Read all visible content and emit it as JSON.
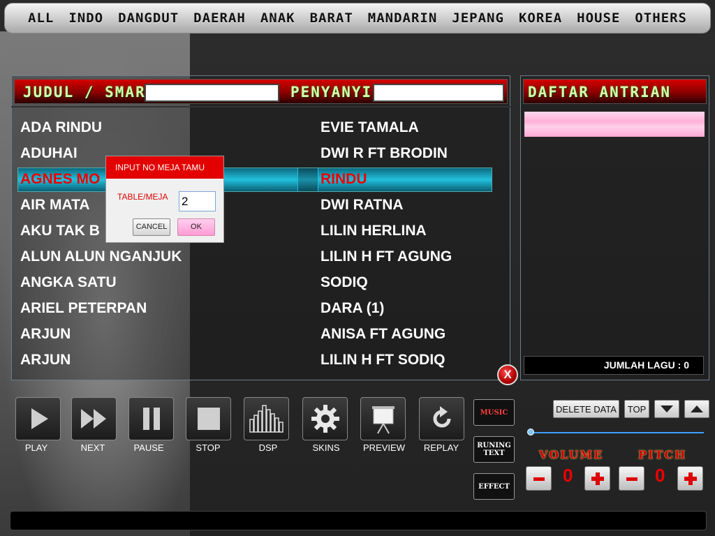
{
  "categories": [
    "ALL",
    "INDO",
    "DANGDUT",
    "DAERAH",
    "ANAK",
    "BARAT",
    "MANDARIN",
    "JEPANG",
    "KOREA",
    "HOUSE",
    "OTHERS"
  ],
  "search": {
    "judul_label": "JUDUL / SMART",
    "penyanyi_label": "PENYANYI",
    "judul_value": "",
    "penyanyi_value": ""
  },
  "songs": [
    "ADA RINDU",
    "ADUHAI",
    "AGNES MO",
    "AIR MATA",
    "AKU TAK B",
    "ALUN ALUN NGANJUK",
    "ANGKA SATU",
    "ARIEL PETERPAN",
    "ARJUN",
    "ARJUN"
  ],
  "artists": [
    "EVIE TAMALA",
    "DWI R FT BRODIN",
    "RINDU",
    "DWI RATNA",
    "LILIN HERLINA",
    "LILIN H FT AGUNG",
    "SODIQ",
    "DARA (1)",
    "ANISA FT AGUNG",
    "LILIN H FT SODIQ"
  ],
  "selected_index": 2,
  "queue": {
    "title": "DAFTAR ANTRIAN",
    "count_label": "JUMLAH LAGU : 0"
  },
  "close_label": "X",
  "controls": [
    {
      "label": "PLAY",
      "icon": "play-icon"
    },
    {
      "label": "NEXT",
      "icon": "next-icon"
    },
    {
      "label": "PAUSE",
      "icon": "pause-icon"
    },
    {
      "label": "STOP",
      "icon": "stop-icon"
    },
    {
      "label": "DSP",
      "icon": "equalizer-icon"
    },
    {
      "label": "SKINS",
      "icon": "gear-icon"
    },
    {
      "label": "PREVIEW",
      "icon": "projector-screen-icon"
    },
    {
      "label": "REPLAY",
      "icon": "replay-icon"
    }
  ],
  "side_buttons": {
    "music": "MUSIC",
    "running_text": "RUNING TEXT",
    "effect": "EFFECT"
  },
  "queue_buttons": {
    "delete": "DELETE DATA",
    "top": "TOP"
  },
  "volume": {
    "label": "VOLUME",
    "value": "0"
  },
  "pitch": {
    "label": "PITCH",
    "value": "0"
  },
  "dialog": {
    "title": "INPUT NO MEJA TAMU",
    "field_label": "TABLE/MEJA",
    "value": "2",
    "cancel": "CANCEL",
    "ok": "OK"
  }
}
